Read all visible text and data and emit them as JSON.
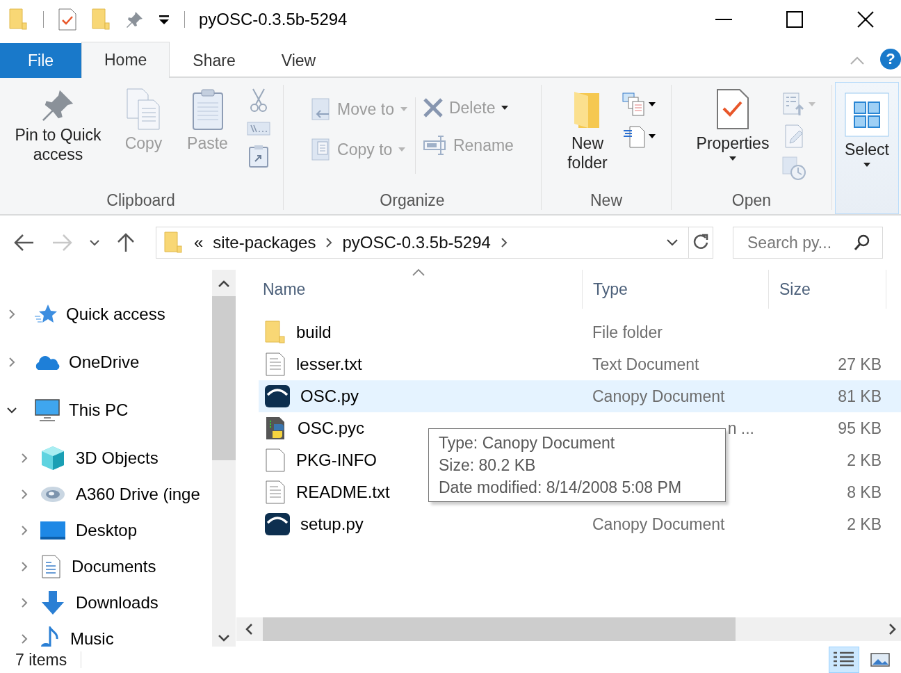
{
  "title_bar": {
    "title": "pyOSC-0.3.5b-5294"
  },
  "ribbon_tabs": [
    {
      "label": "File",
      "kind": "file",
      "selected": false
    },
    {
      "label": "Home",
      "kind": "tab",
      "selected": true
    },
    {
      "label": "Share",
      "kind": "tab",
      "selected": false
    },
    {
      "label": "View",
      "kind": "tab",
      "selected": false
    }
  ],
  "help": "?",
  "ribbon": {
    "clipboard": {
      "label": "Clipboard",
      "pin": {
        "label": "Pin to Quick access",
        "disabled": false
      },
      "copy": {
        "label": "Copy",
        "disabled": true
      },
      "paste": {
        "label": "Paste",
        "disabled": true
      }
    },
    "organize": {
      "label": "Organize",
      "move_to": {
        "label": "Move to",
        "disabled": true
      },
      "copy_to": {
        "label": "Copy to",
        "disabled": true
      },
      "delete": {
        "label": "Delete",
        "disabled": true
      },
      "rename": {
        "label": "Rename",
        "disabled": true
      }
    },
    "new": {
      "label": "New",
      "new_folder": {
        "label": "New folder",
        "disabled": false
      }
    },
    "open": {
      "label": "Open",
      "properties": {
        "label": "Properties",
        "disabled": false
      }
    },
    "select": {
      "label": "Select",
      "selected": true
    }
  },
  "navigation": {
    "forward_disabled": true
  },
  "address": {
    "overflow": "«",
    "crumbs": [
      "site-packages",
      "pyOSC-0.3.5b-5294"
    ]
  },
  "search": {
    "placeholder": "Search py..."
  },
  "sidebar": {
    "items": [
      {
        "label": "Quick access",
        "expanded": false
      },
      {
        "label": "OneDrive",
        "expanded": false
      },
      {
        "label": "This PC",
        "expanded": true,
        "children": [
          {
            "label": "3D Objects",
            "expanded": false
          },
          {
            "label": "A360 Drive (inge",
            "expanded": false
          },
          {
            "label": "Desktop",
            "expanded": false
          },
          {
            "label": "Documents",
            "expanded": false
          },
          {
            "label": "Downloads",
            "expanded": false
          },
          {
            "label": "Music",
            "expanded": false
          }
        ]
      }
    ]
  },
  "table": {
    "columns": [
      "Name",
      "Type",
      "Size"
    ],
    "rows": [
      {
        "name": "build",
        "kind": "folder",
        "type": "File folder",
        "selected": false
      },
      {
        "name": "lesser.txt",
        "kind": "text",
        "type": "Text Document",
        "size": "27 KB",
        "selected": false
      },
      {
        "name": "OSC.py",
        "kind": "canopy",
        "type": "Canopy Document",
        "size": "81 KB",
        "selected": true
      },
      {
        "name": "OSC.pyc",
        "kind": "compiled",
        "type": "n ...",
        "type_covered": true,
        "size": "95 KB",
        "selected": false
      },
      {
        "name": "PKG-INFO",
        "kind": "file",
        "size": "2 KB",
        "selected": false
      },
      {
        "name": "README.txt",
        "kind": "text",
        "size": "8 KB",
        "selected": false
      },
      {
        "name": "setup.py",
        "kind": "canopy",
        "type": "Canopy Document",
        "size": "2 KB",
        "selected": false
      }
    ]
  },
  "tooltip": {
    "lines": [
      "Type: Canopy Document",
      "Size: 80.2 KB",
      "Date modified: 8/14/2008 5:08 PM"
    ]
  },
  "status_bar": {
    "count": "7 items",
    "views": [
      {
        "selected": true
      },
      {
        "selected": false
      }
    ]
  }
}
